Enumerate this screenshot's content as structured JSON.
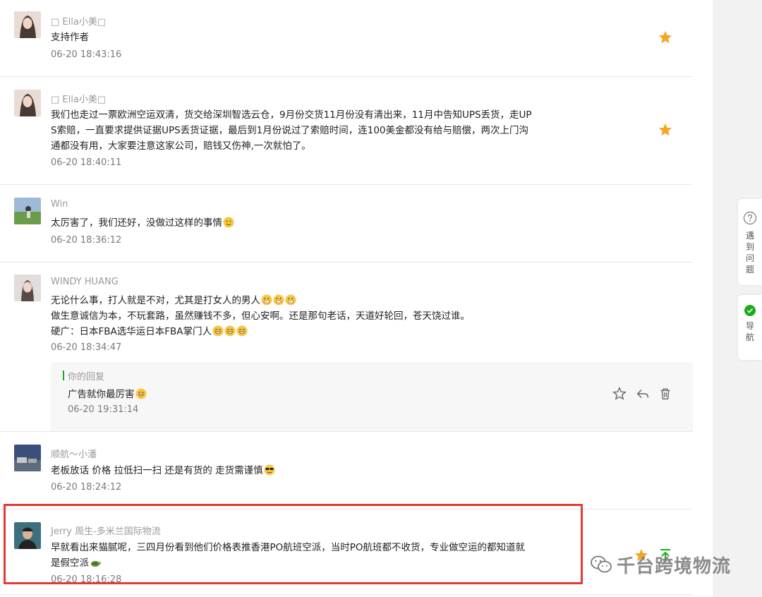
{
  "comments": [
    {
      "name": "Ella小美",
      "content": "支持作者",
      "time": "06-20 18:43:16"
    },
    {
      "name": "Ella小美",
      "content_lines": [
        "我们也走过一票欧洲空运双清，货交给深圳智选云仓，9月份交货11月份没有清出来，11月中告知UPS丢货，走UP",
        "S索赔，一直要求提供证据UPS丢货证据，最后到1月份说过了索赔时间，连100美金都没有给与赔偿，两次上门沟",
        "通都没有用，大家要注意这家公司，赔钱又伤神,一次就怕了。"
      ],
      "time": "06-20 18:40:11"
    },
    {
      "name": "Win",
      "content": "太厉害了，我们还好，没做过这样的事情",
      "time": "06-20 18:36:12"
    },
    {
      "name": "WINDY HUANG",
      "content_lines": [
        "无论什么事，打人就是不对，尤其是打女人的男人",
        "做生意诚信为本，不玩套路，虽然赚钱不多，但心安啊。还是那句老话，天道好轮回，苍天饶过谁。",
        "硬广：日本FBA选华运日本FBA掌门人"
      ],
      "time": "06-20 18:34:47"
    },
    {
      "name": "顺航～小潘",
      "content": "老板放话  价格  拉低扫一扫  还是有货的  走货需谨慎",
      "time": "06-20 18:24:12"
    },
    {
      "name": "Jerry 周生-多米兰国际物流",
      "content_lines": [
        "早就看出来猫腻呢，三四月份看到他们价格表推香港PO航班空派，当时PO航班都不收货，专业做空运的都知道就",
        "是假空派"
      ],
      "time": "06-20 18:16:28"
    }
  ],
  "reply": {
    "label": "你的回复",
    "content": "广告就你最厉害",
    "time": "06-20 19:31:14"
  },
  "sidebar": {
    "report_label_chars": [
      "遇",
      "到",
      "问",
      "题"
    ],
    "nav_label_chars": [
      "导",
      "航"
    ]
  },
  "watermark": {
    "text": "千台跨境物流"
  },
  "colors": {
    "star": "#f5a623",
    "accent_green": "#1aad19",
    "highlight_red": "#e53935"
  }
}
